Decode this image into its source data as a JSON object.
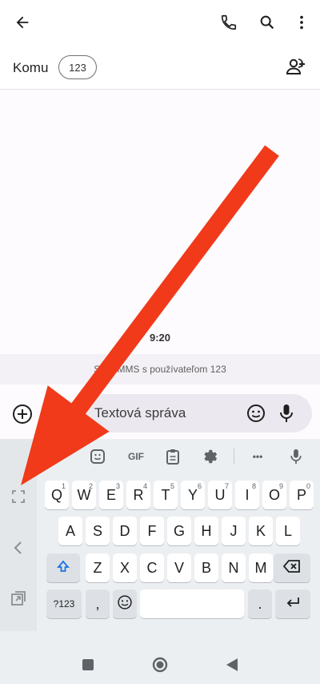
{
  "header": {
    "to_label": "Komu",
    "recipient": "123"
  },
  "conversation": {
    "time": "9:20",
    "info": "SMS/MMS s používateľom 123"
  },
  "compose": {
    "placeholder": "Textová správa"
  },
  "keyboard": {
    "toolbar_gif": "GIF",
    "toolbar_more": "•••",
    "row1": [
      {
        "k": "Q",
        "alt": "1"
      },
      {
        "k": "W",
        "alt": "2"
      },
      {
        "k": "E",
        "alt": "3"
      },
      {
        "k": "R",
        "alt": "4"
      },
      {
        "k": "T",
        "alt": "5"
      },
      {
        "k": "Y",
        "alt": "6"
      },
      {
        "k": "U",
        "alt": "7"
      },
      {
        "k": "I",
        "alt": "8"
      },
      {
        "k": "O",
        "alt": "9"
      },
      {
        "k": "P",
        "alt": "0"
      }
    ],
    "row2": [
      "A",
      "S",
      "D",
      "F",
      "G",
      "H",
      "J",
      "K",
      "L"
    ],
    "row3": [
      "Z",
      "X",
      "C",
      "V",
      "B",
      "N",
      "M"
    ],
    "symbols_key": "?123",
    "comma_key": ",",
    "period_key": "."
  },
  "colors": {
    "annotation_arrow": "#f03a1a",
    "shift_accent": "#1a73e8"
  },
  "icons": [
    "back-arrow-icon",
    "phone-icon",
    "search-icon",
    "more-vert-icon",
    "add-contact-icon",
    "add-circle-icon",
    "gallery-icon",
    "emoji-icon",
    "mic-icon",
    "sticker-icon",
    "clipboard-icon",
    "settings-icon",
    "fullscreen-icon",
    "chevron-left-icon",
    "resize-icon",
    "shift-icon",
    "backspace-icon",
    "enter-icon",
    "nav-square-icon",
    "nav-circle-icon",
    "nav-back-icon"
  ]
}
